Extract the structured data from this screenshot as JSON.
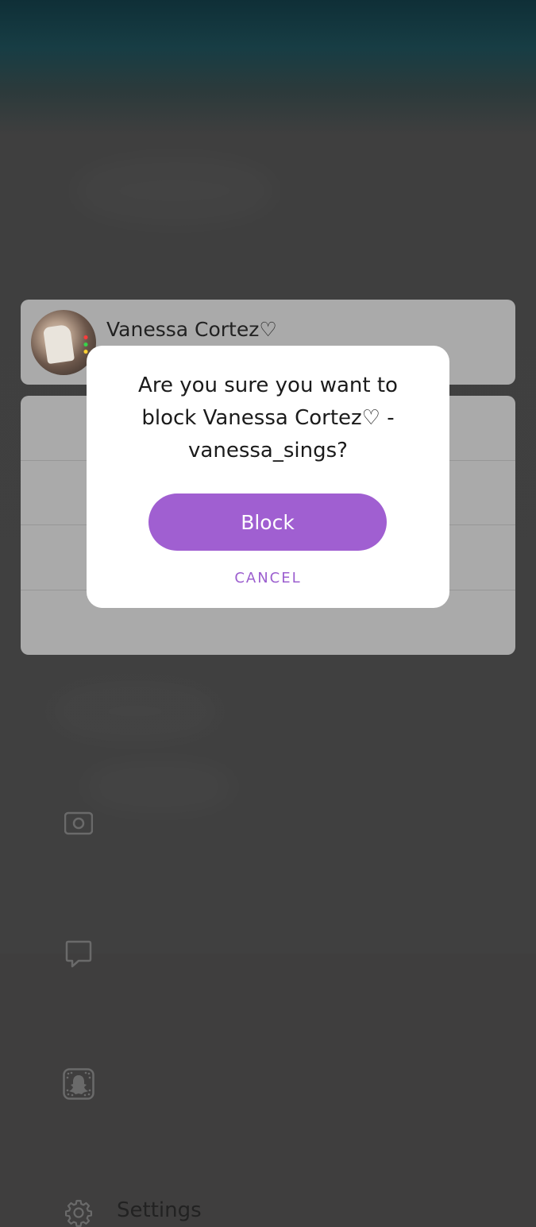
{
  "profile": {
    "name": "Vanessa Cortez♡"
  },
  "menu": {
    "items": [
      {
        "label": "",
        "icon": "camera-icon"
      },
      {
        "label": "",
        "icon": "chat-icon"
      },
      {
        "label": "",
        "icon": "snapcode-icon"
      },
      {
        "label": "Settings",
        "icon": "gear-icon"
      }
    ]
  },
  "dialog": {
    "message": "Are you sure you want to block Vanessa Cortez♡ - vanessa_sings?",
    "confirm_label": "Block",
    "cancel_label": "CANCEL"
  },
  "colors": {
    "accent": "#a05fd1",
    "card": "#aaaaaa",
    "overlay": "#3f3f3f"
  }
}
